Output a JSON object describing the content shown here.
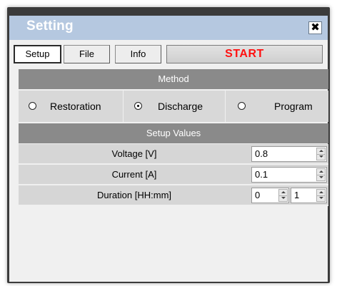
{
  "window": {
    "title": "Setting",
    "close_glyph": "✖"
  },
  "tabs": [
    {
      "label": "Setup",
      "active": true
    },
    {
      "label": "File",
      "active": false
    },
    {
      "label": "Info",
      "active": false
    }
  ],
  "start_button": {
    "label": "START",
    "color": "#ff1010"
  },
  "method": {
    "header": "Method",
    "options": [
      {
        "label": "Restoration",
        "selected": false
      },
      {
        "label": "Discharge",
        "selected": true
      },
      {
        "label": "Program",
        "selected": false
      }
    ]
  },
  "setup_values": {
    "header": "Setup Values",
    "rows": [
      {
        "label": "Voltage [V]",
        "value": "0.8"
      },
      {
        "label": "Current [A]",
        "value": "0.1"
      },
      {
        "label": "Duration [HH:mm]",
        "hours": "0",
        "minutes": "1"
      }
    ]
  },
  "colors": {
    "titlebar": "#b5c8e0",
    "section_header": "#8a8a8a",
    "row_background": "#d6d6d6",
    "start_text": "#ff1010"
  }
}
